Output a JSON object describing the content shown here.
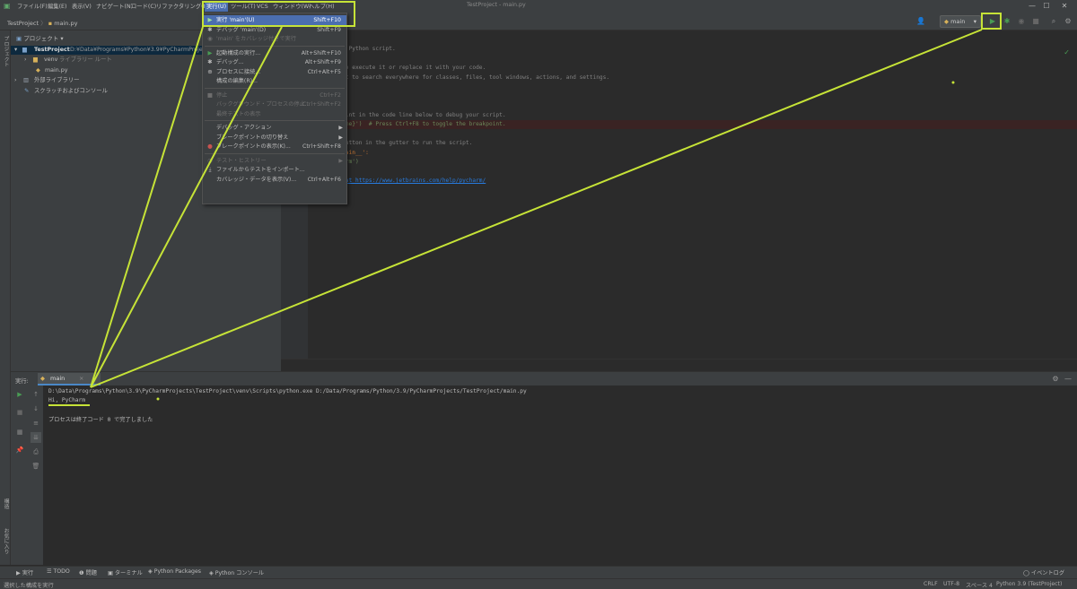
{
  "window": {
    "title": "TestProject - main.py",
    "controls": [
      "—",
      "☐",
      "✕"
    ]
  },
  "menubar": {
    "items": [
      "ファイル(F)",
      "編集(E)",
      "表示(V)",
      "ナビゲート(N)",
      "コード(C)",
      "リファクタリング(R)",
      "実行(U)",
      "ツール(T)",
      "VCS",
      "ウィンドウ(W)",
      "ヘルプ(H)"
    ]
  },
  "breadcrumb": {
    "project": "TestProject",
    "sep": "〉",
    "file": "main.py"
  },
  "toolbar": {
    "run_config": "main",
    "run_icon": "play-icon"
  },
  "project_panel": {
    "header": "プロジェクト",
    "tree": [
      {
        "label": "TestProject",
        "path": "D:¥Data¥Programs¥Python¥3.9¥PyCharmProjects¥Tes",
        "level": 0,
        "arrow": "▾",
        "icon": "folder-icon"
      },
      {
        "label": "venv",
        "suffix": "ライブラリー ルート",
        "level": 1,
        "arrow": "›",
        "icon": "folder-icon"
      },
      {
        "label": "main.py",
        "level": 2,
        "arrow": "",
        "icon": "python-file-icon"
      },
      {
        "label": "外部ライブラリー",
        "level": 0,
        "arrow": "›",
        "icon": "library-icon"
      },
      {
        "label": "スクラッチおよびコンソール",
        "level": 0,
        "arrow": "",
        "icon": "scratch-icon"
      }
    ]
  },
  "left_stripe": {
    "project_label": "プロジェクト",
    "structure_label": "構造",
    "favorites_label": "お気に入り"
  },
  "editor": {
    "lines": [
      {
        "text": "e sample Python script.",
        "cls": "c-com"
      },
      {
        "text": "",
        "cls": ""
      },
      {
        "text": "ft+F10 to execute it or replace it with your code.",
        "cls": "c-com"
      },
      {
        "text": "ble Shift to search everywhere for classes, files, tool windows, actions, and settings.",
        "cls": "c-com"
      },
      {
        "text": "",
        "cls": ""
      },
      {
        "text": "",
        "cls": ""
      },
      {
        "text": "i(name):",
        "cls": "c-fn"
      },
      {
        "text": " breakpoint in the code line below to debug your script.",
        "cls": "c-com"
      },
      {
        "text": "'Hi, {name}')  # Press Ctrl+F8 to toggle the breakpoint.",
        "cls": "c-str"
      },
      {
        "text": "",
        "cls": ""
      },
      {
        "text": " green button in the gutter to run the script.",
        "cls": "c-com"
      },
      {
        "text": " == '__main__':",
        "cls": "c-kw"
      },
      {
        "text": "i('PyCharm')",
        "cls": "c-str"
      },
      {
        "text": "",
        "cls": ""
      },
      {
        "text": "rm help at https://www.jetbrains.com/help/pycharm/",
        "cls": "c-link"
      }
    ]
  },
  "run_menu": {
    "items": [
      {
        "icon": "▶",
        "label": "実行 'main'(U)",
        "shortcut": "Shift+F10",
        "state": "highlight"
      },
      {
        "icon": "✱",
        "label": "デバッグ 'main'(D)",
        "shortcut": "Shift+F9",
        "state": "normal"
      },
      {
        "icon": "◉",
        "label": "'main' をカバレッジ付きで実行",
        "shortcut": "",
        "state": "disabled"
      },
      {
        "sep": true
      },
      {
        "icon": "▶",
        "label": "起動構成の実行...",
        "shortcut": "Alt+Shift+F10",
        "state": "normal"
      },
      {
        "icon": "✱",
        "label": "デバッグ...",
        "shortcut": "Alt+Shift+F9",
        "state": "normal"
      },
      {
        "icon": "⊕",
        "label": "プロセスに接続...",
        "shortcut": "Ctrl+Alt+F5",
        "state": "normal"
      },
      {
        "icon": "",
        "label": "構成の編集(R)...",
        "shortcut": "",
        "state": "normal"
      },
      {
        "sep": true
      },
      {
        "icon": "■",
        "label": "停止",
        "shortcut": "Ctrl+F2",
        "state": "disabled"
      },
      {
        "icon": "",
        "label": "バックグラウンド・プロセスの停止...",
        "shortcut": "Ctrl+Shift+F2",
        "state": "disabled"
      },
      {
        "icon": "",
        "label": "最終テストの表示",
        "shortcut": "",
        "state": "disabled"
      },
      {
        "sep": true
      },
      {
        "icon": "",
        "label": "デバッグ・アクション",
        "shortcut": "",
        "state": "normal",
        "arrow": "▶"
      },
      {
        "icon": "",
        "label": "ブレークポイントの切り替え",
        "shortcut": "",
        "state": "normal",
        "arrow": "▶"
      },
      {
        "icon": "●",
        "label": "ブレークポイントの表示(K)...",
        "shortcut": "Ctrl+Shift+F8",
        "state": "normal"
      },
      {
        "sep": true
      },
      {
        "icon": "◷",
        "label": "テスト・ヒストリー",
        "shortcut": "",
        "state": "disabled",
        "arrow": "▶"
      },
      {
        "icon": "⤓",
        "label": "ファイルからテストをインポート...",
        "shortcut": "",
        "state": "normal"
      },
      {
        "icon": "",
        "label": "カバレッジ・データを表示(V)...",
        "shortcut": "Ctrl+Alt+F6",
        "state": "normal"
      }
    ]
  },
  "run_window": {
    "label": "実行:",
    "tab": "main",
    "console": [
      "D:\\Data\\Programs\\Python\\3.9\\PyCharmProjects\\TestProject\\venv\\Scripts\\python.exe D:/Data/Programs/Python/3.9/PyCharmProjects/TestProject/main.py",
      "Hi, PyCharm",
      "",
      "プロセスは終了コード 0 で完了しました"
    ]
  },
  "tool_window_bar": {
    "items": [
      "▶ 実行",
      "☰ TODO",
      "❶ 問題",
      "▣ ターミナル",
      "◈ Python Packages",
      "◈ Python コンソール"
    ],
    "event_log": "◯ イベントログ"
  },
  "statusbar": {
    "message": "選択した構成を実行",
    "line_sep": "CRLF",
    "encoding": "UTF-8",
    "indent": "スペース 4",
    "interpreter": "Python 3.9 (TestProject)"
  },
  "colors": {
    "accent": "#c6e337",
    "selection": "#4b6eaf",
    "run_green": "#499c54"
  }
}
